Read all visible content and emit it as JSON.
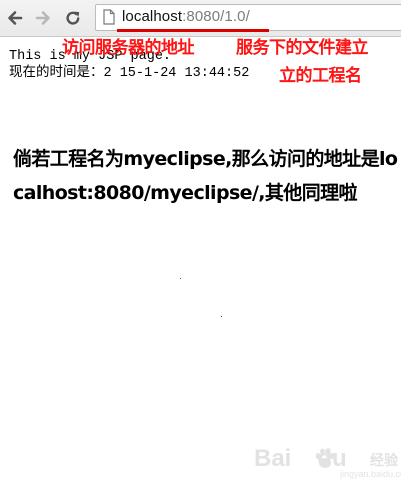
{
  "browser": {
    "url_host": "localhost",
    "url_rest": ":8080/1.0/"
  },
  "page": {
    "line1": "This is my JSP page.",
    "line2": "现在的时间是：2 15-1-24 13:44:52"
  },
  "annotations": {
    "left": "访问服务器的地址",
    "right_line1": "服务下的文件建立",
    "right_line2": "立的工程名",
    "note": "倘若工程名为myeclipse,那么访问的地址是localhost:8080/myeclipse/,其他同理啦",
    "color": "#ff1414"
  },
  "watermark": {
    "brand": "Bai",
    "brand2": "du",
    "sub": "经验",
    "url": "jingyan.baidu.com"
  },
  "icons": [
    "back-arrow-icon",
    "forward-arrow-icon",
    "reload-icon",
    "page-icon",
    "paw-icon"
  ]
}
